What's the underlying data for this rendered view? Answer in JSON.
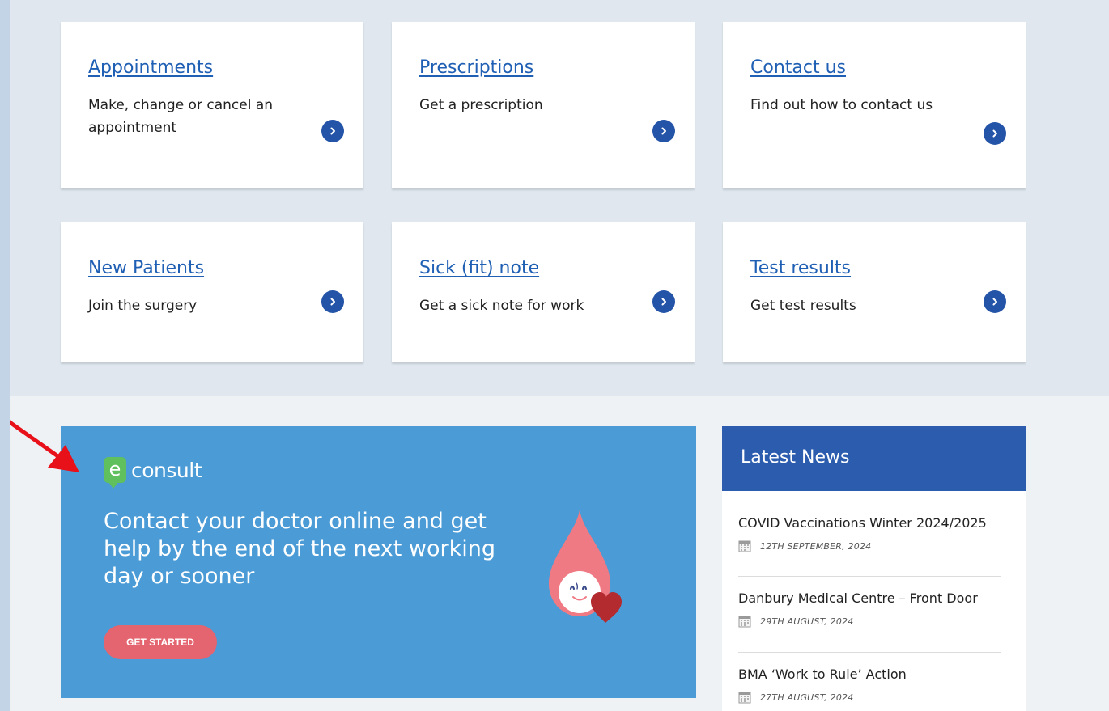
{
  "tiles": [
    {
      "title": "Appointments",
      "description": "Make, change or cancel an appointment"
    },
    {
      "title": "Prescriptions",
      "description": "Get a prescription"
    },
    {
      "title": "Contact us",
      "description": "Find out how to contact us"
    },
    {
      "title": "New Patients",
      "description": "Join the surgery"
    },
    {
      "title": "Sick (fit) note",
      "description": "Get a sick note for work"
    },
    {
      "title": "Test results",
      "description": "Get test results"
    }
  ],
  "econsult": {
    "logo_letter": "e",
    "logo_text": "consult",
    "headline": "Contact your doctor online and get help by the end of the next working day or sooner",
    "button_label": "GET STARTED"
  },
  "news": {
    "title": "Latest News",
    "items": [
      {
        "headline": "COVID Vaccinations Winter 2024/2025",
        "date": "12TH SEPTEMBER, 2024"
      },
      {
        "headline": "Danbury Medical Centre – Front Door",
        "date": "29TH AUGUST, 2024"
      },
      {
        "headline": "BMA ‘Work to Rule’ Action",
        "date": "27TH AUGUST, 2024"
      }
    ]
  },
  "icons": {
    "tile_arrow": "chevron-right-circle-icon",
    "news_date": "calendar-icon",
    "illustration": "blood-drop-heart-icon",
    "annotation": "red-arrow-icon"
  },
  "colors": {
    "link_blue": "#1f5fb4",
    "arrow_circle": "#2454a8",
    "econsult_bg": "#4a9bd6",
    "econsult_button": "#e4646f",
    "news_header": "#2c5cae",
    "annotation_red": "#e8111a"
  }
}
